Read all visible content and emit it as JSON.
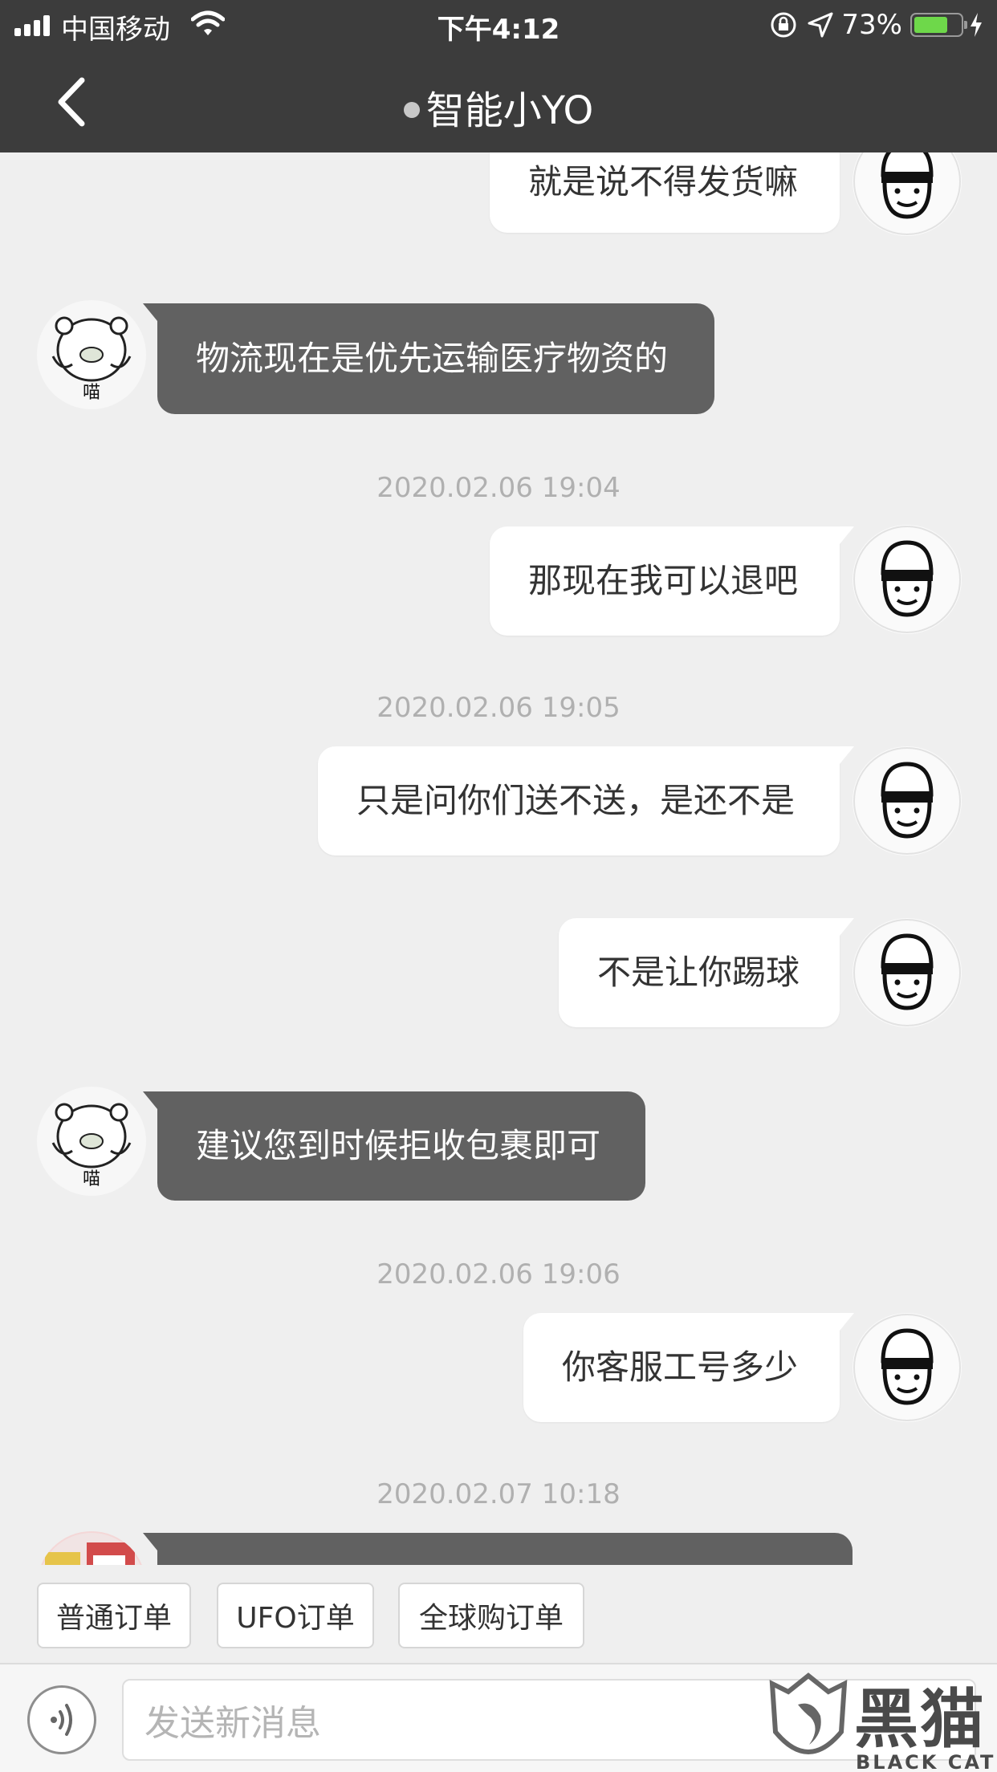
{
  "status_bar": {
    "carrier": "中国移动",
    "time": "下午4:12",
    "battery_percent": "73%",
    "battery_level": 0.73,
    "icons": [
      "signal-icon",
      "wifi-icon",
      "orientation-lock-icon",
      "location-icon",
      "battery-icon",
      "charging-icon"
    ]
  },
  "nav": {
    "title": "智能小YO",
    "back_icon": "chevron-left-icon"
  },
  "messages": [
    {
      "type": "out",
      "text": "就是说不得发货嘛"
    },
    {
      "type": "in",
      "text": "物流现在是优先运输医疗物资的"
    },
    {
      "type": "time",
      "text": "2020.02.06 19:04"
    },
    {
      "type": "out",
      "text": "那现在我可以退吧"
    },
    {
      "type": "time",
      "text": "2020.02.06 19:05"
    },
    {
      "type": "out",
      "text": "只是问你们送不送，是还不是"
    },
    {
      "type": "out",
      "text": "不是让你踢球"
    },
    {
      "type": "in",
      "text": "建议您到时候拒收包裹即可"
    },
    {
      "type": "time",
      "text": "2020.02.06 19:06"
    },
    {
      "type": "out",
      "text": "你客服工号多少"
    },
    {
      "type": "time",
      "text": "2020.02.07 10:18"
    },
    {
      "type": "in",
      "text": ""
    }
  ],
  "avatars": {
    "bot_label": "喵",
    "user_icon": "cartoon-face-avatar",
    "bot_icon": "bear-meme-avatar"
  },
  "quick_buttons": [
    "普通订单",
    "UFO订单",
    "全球购订单"
  ],
  "input": {
    "placeholder": "发送新消息",
    "voice_icon": "voice-icon"
  },
  "watermark": {
    "text": "黑猫",
    "sub": "BLACK CAT"
  },
  "colors": {
    "header": "#3c3c3c",
    "incoming_bubble": "#616161",
    "outgoing_bubble": "#ffffff",
    "background": "#efefef",
    "battery": "#6ed84a"
  }
}
